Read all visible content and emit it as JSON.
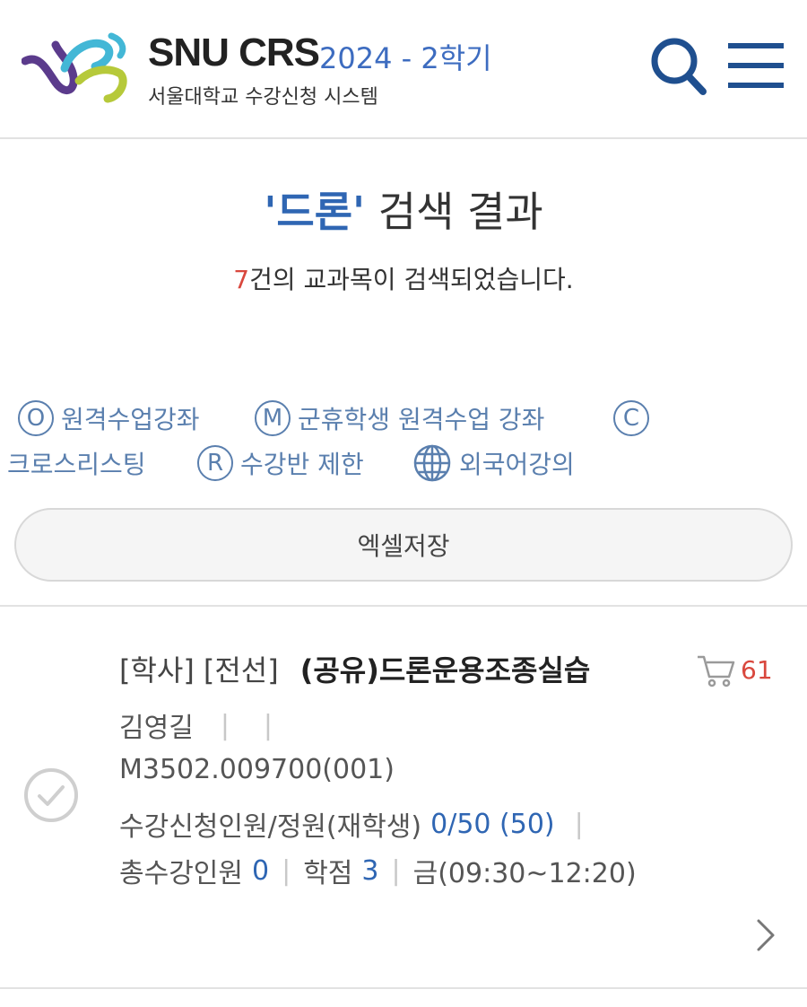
{
  "header": {
    "brand": "SNU CRS",
    "term": "2024 - 2학기",
    "subtitle": "서울대학교 수강신청 시스템",
    "logo_icon": "snu-crs-logo",
    "search_icon": "search-icon",
    "menu_icon": "hamburger-menu-icon"
  },
  "search": {
    "keyword": "'드론'",
    "title_suffix": " 검색 결과",
    "count": "7",
    "count_suffix": "건의 교과목이 검색되었습니다."
  },
  "legend": [
    {
      "badge": "O",
      "label": "원격수업강좌"
    },
    {
      "badge": "M",
      "label": "군휴학생 원격수업 강좌"
    },
    {
      "badge": "C",
      "label": ""
    },
    {
      "badge": "",
      "label": "크로스리스팅"
    },
    {
      "badge": "R",
      "label": "수강반 제한"
    },
    {
      "badge": "globe",
      "label": "외국어강의"
    }
  ],
  "excel_button": "엑셀저장",
  "course": {
    "tag_program": "[학사]",
    "tag_type": "[전선]",
    "name": "(공유)드론운용조종실습",
    "cart_count": "61",
    "professor": "김영길",
    "professor_sep1": "|",
    "professor_sep2": "|",
    "code": "M3502.009700(001)",
    "enroll_label": "수강신청인원/정원(재학생)",
    "enroll_value": "0/50 (50)",
    "total_label": "총수강인원",
    "total_value": "0",
    "credit_label": "학점",
    "credit_value": "3",
    "schedule": "금(09:30~12:20)",
    "sep": "|"
  },
  "colors": {
    "accent_blue": "#2f66b3",
    "count_red": "#d9473d",
    "legend_blue": "#5a7fae",
    "logo_purple": "#5b3b8c",
    "logo_cyan": "#43b7d6",
    "logo_green": "#b6c93a"
  }
}
